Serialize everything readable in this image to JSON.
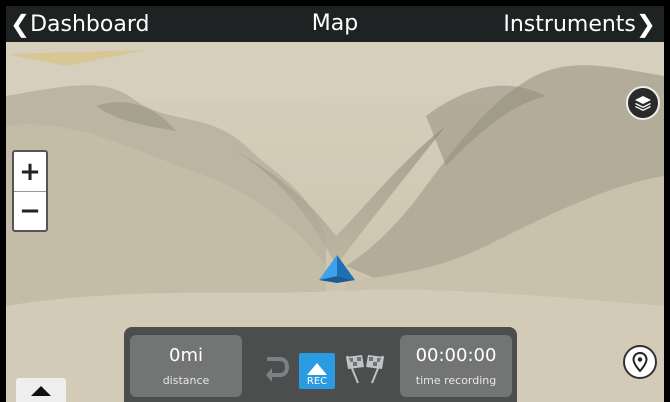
{
  "nav": {
    "back_label": "Dashboard",
    "title": "Map",
    "forward_label": "Instruments"
  },
  "zoom": {
    "in_label": "+",
    "out_label": "−"
  },
  "stats": {
    "distance_value": "0mi",
    "distance_label": "distance",
    "time_value": "00:00:00",
    "time_label": "time recording"
  },
  "recording": {
    "rec_label": "REC"
  },
  "icons": {
    "layers": "layers-icon",
    "location": "map-pin-icon",
    "expand": "chevron-up-icon",
    "undo": "undo-icon",
    "finish": "checkered-flags-icon",
    "position": "position-marker-icon"
  },
  "colors": {
    "navbar": "#12161a",
    "rec_accent": "#2a9be0",
    "marker": "#2f8fd8",
    "terrain": "#cfc6b1"
  }
}
